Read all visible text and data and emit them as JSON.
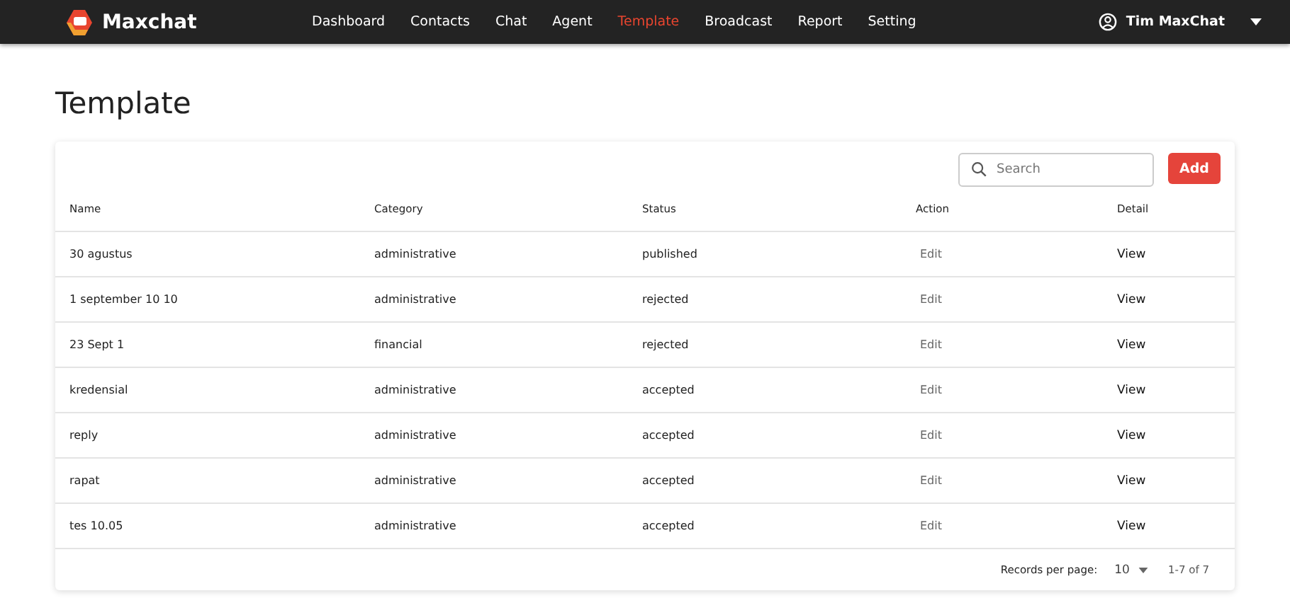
{
  "app": {
    "name": "Maxchat"
  },
  "nav": [
    {
      "label": "Dashboard",
      "selected": false
    },
    {
      "label": "Contacts",
      "selected": false
    },
    {
      "label": "Chat",
      "selected": false
    },
    {
      "label": "Agent",
      "selected": false
    },
    {
      "label": "Template",
      "selected": true
    },
    {
      "label": "Broadcast",
      "selected": false
    },
    {
      "label": "Report",
      "selected": false
    },
    {
      "label": "Setting",
      "selected": false
    }
  ],
  "user": {
    "name": "Tim MaxChat"
  },
  "page_title": "Template",
  "search": {
    "placeholder": "Search"
  },
  "add_button": "Add",
  "table": {
    "columns": [
      "Name",
      "Category",
      "Status",
      "Action",
      "Detail"
    ],
    "rows": [
      [
        "30 agustus",
        "administrative",
        "published",
        "Edit",
        "View"
      ],
      [
        "1 september 10 10",
        "administrative",
        "rejected",
        "Edit",
        "View"
      ],
      [
        "23 Sept 1",
        "financial",
        "rejected",
        "Edit",
        "View"
      ],
      [
        "kredensial",
        "administrative",
        "accepted",
        "Edit",
        "View"
      ],
      [
        "reply",
        "administrative",
        "accepted",
        "Edit",
        "View"
      ],
      [
        "rapat",
        "administrative",
        "accepted",
        "Edit",
        "View"
      ],
      [
        "tes 10.05",
        "administrative",
        "accepted",
        "Edit",
        "View"
      ]
    ]
  },
  "pagination": {
    "label": "Records per page:",
    "per_page": "10",
    "range": "1-7 of 7"
  }
}
